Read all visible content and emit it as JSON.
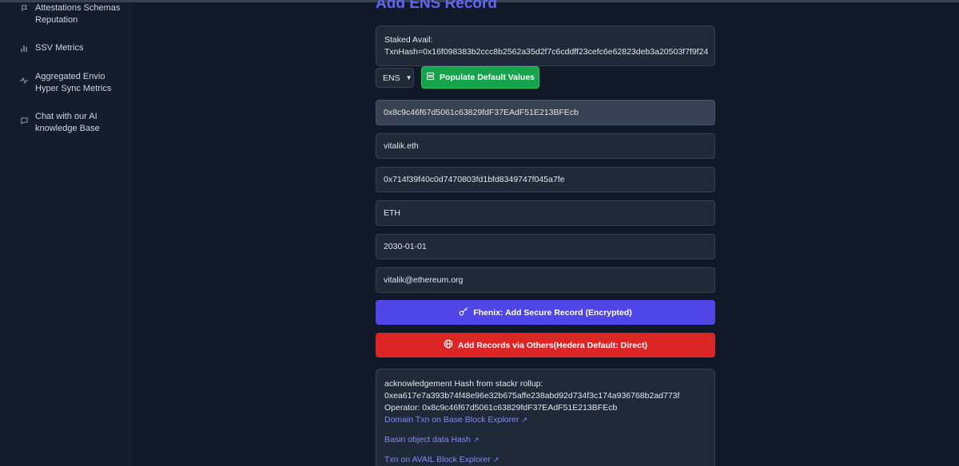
{
  "sidebar": {
    "items": [
      {
        "label": "Attestations Schemas\nReputation",
        "icon": "flag-icon"
      },
      {
        "label": "SSV Metrics",
        "icon": "bar-chart-icon"
      },
      {
        "label": "Aggregated Envio\nHyper Sync Metrics",
        "icon": "activity-icon"
      },
      {
        "label": "Chat with our AI\nknowledge Base",
        "icon": "message-icon"
      }
    ]
  },
  "main": {
    "title": "Add ENS Record",
    "staked": {
      "label": "Staked Avail:",
      "txn": "TxnHash=0x16f098383b2ccc8b2562a35d2f7c6cddff23cefc6e62823deb3a20503f7f9f24"
    },
    "select_value": "ENS",
    "populate_button": "Populate Default Values",
    "fields": [
      "0x8c9c46f67d5061c63829fdF37EAdF51E213BFEcb",
      "vitalik.eth",
      "0x714f39f40c0d7470803fd1bfd8349747f045a7fe",
      "ETH",
      "2030-01-01",
      "vitalik@ethereum.org"
    ],
    "fhenix_button": "Fhenix: Add Secure Record (Encrypted)",
    "others_button": "Add Records via Others(Hedera Default: Direct)",
    "result": {
      "ack_label": "acknowledgement Hash from stackr rollup:",
      "ack_hash": "0xea617e7a393b74f48e96e32b675affe238abd92d734f3c174a936768b2ad773f",
      "operator": "Operator: 0x8c9c46f67d5061c63829fdF37EAdF51E213BFEcb",
      "link_base": "Domain Txn on Base Block Explorer",
      "link_basin": "Basin object data Hash",
      "link_avail": "Txn on AVAIL Block Explorer"
    }
  },
  "colors": {
    "accent": "#6366f1",
    "green": "#16a34a",
    "indigo": "#4f46e5",
    "red": "#dc2626",
    "link": "#818cf8"
  }
}
